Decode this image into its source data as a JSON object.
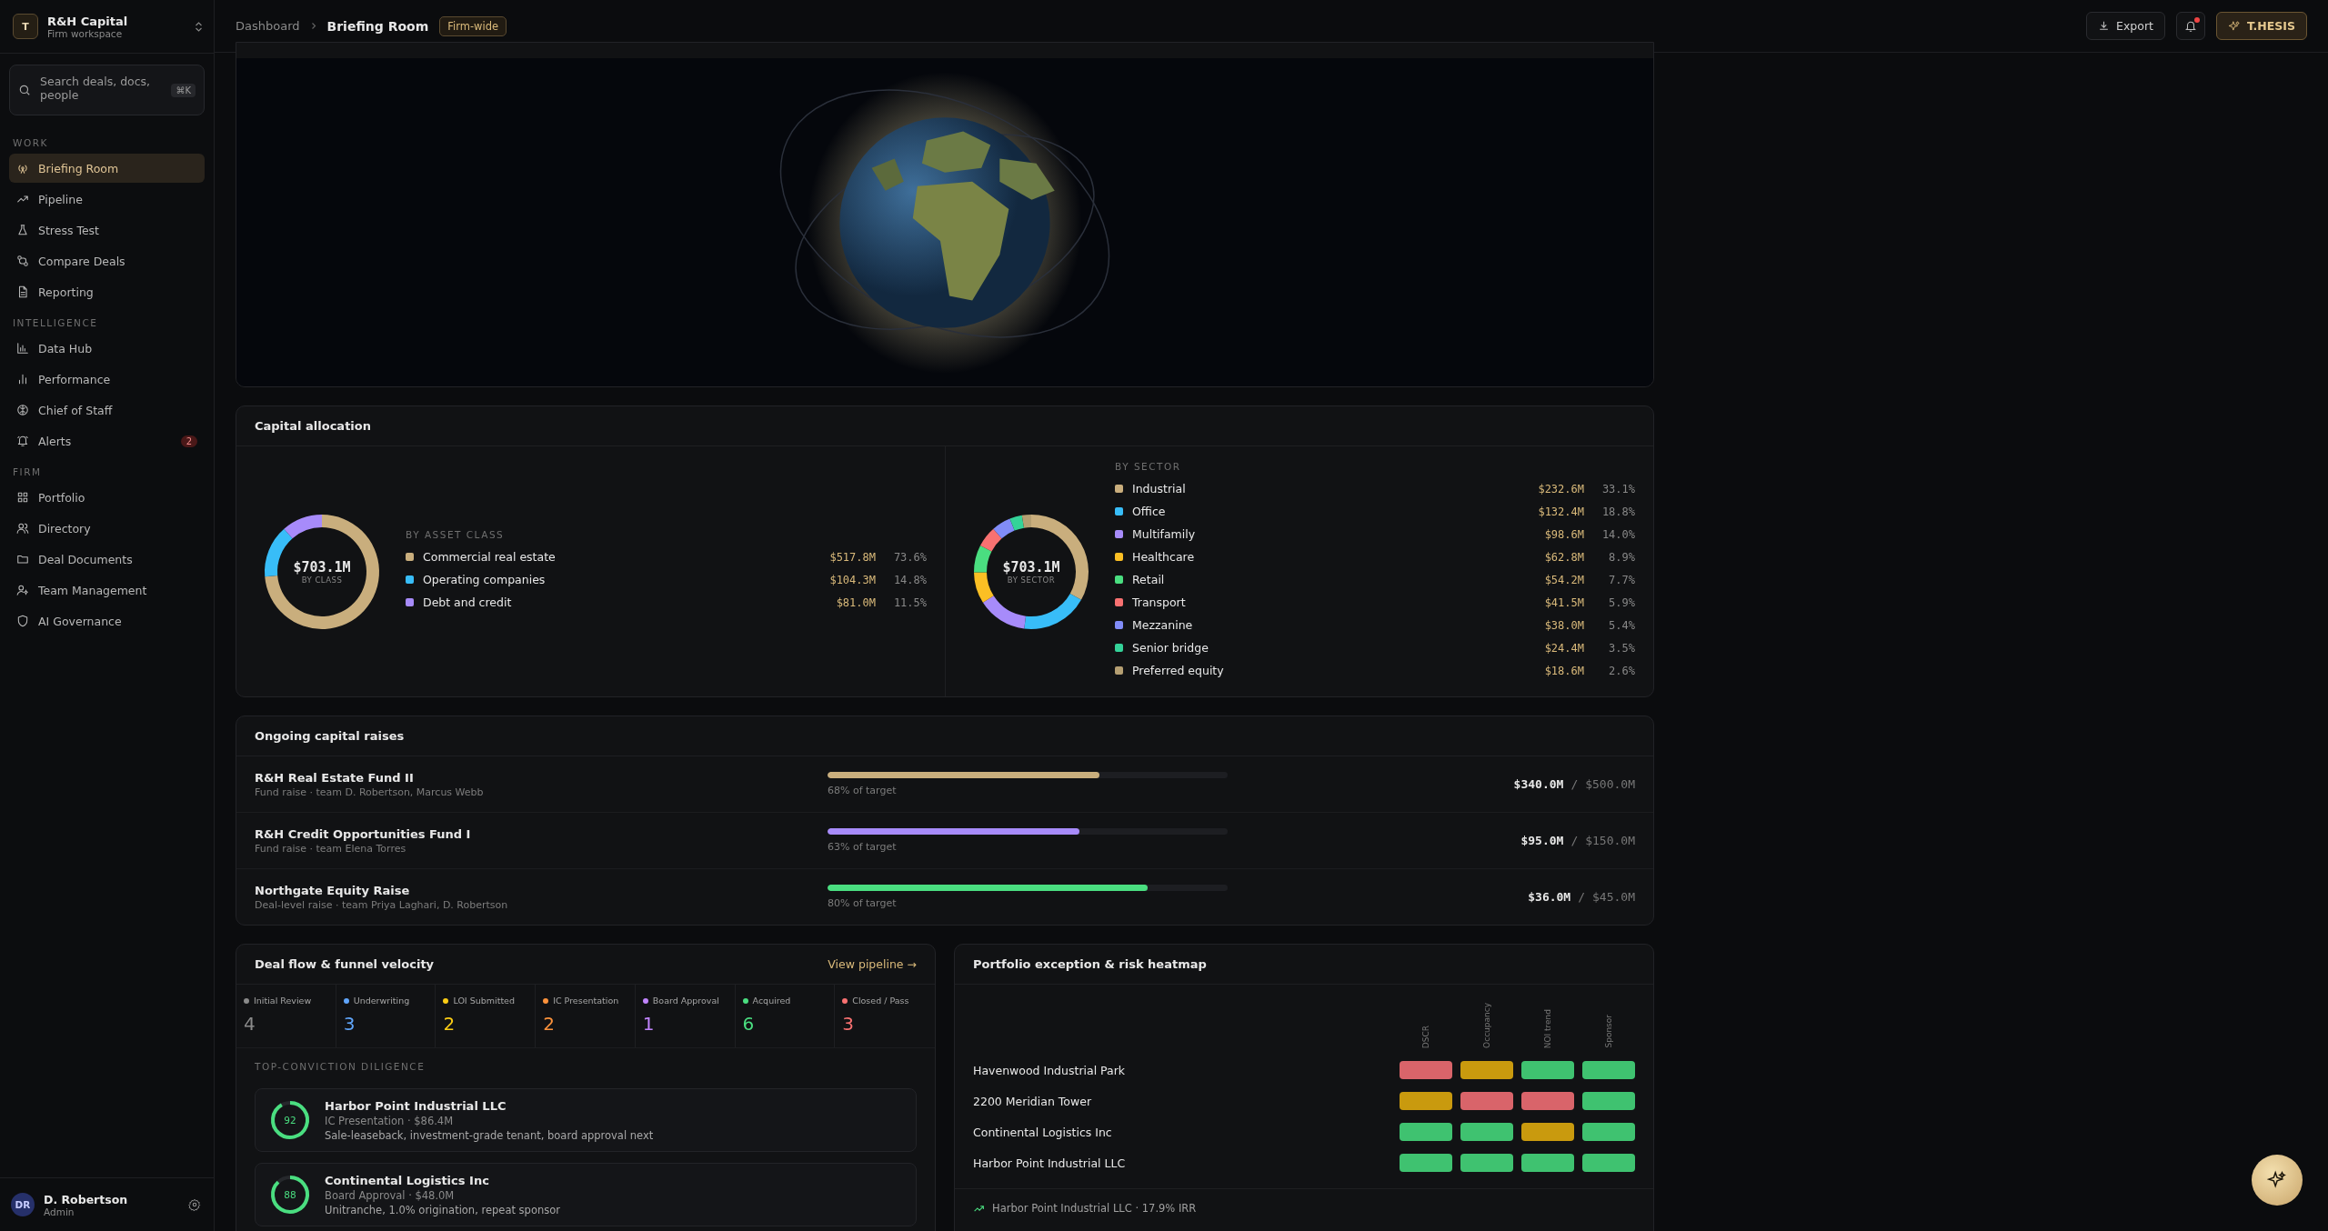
{
  "sidebar": {
    "logo": "T",
    "org": "R&H Capital",
    "workspace": "Firm workspace",
    "search": {
      "placeholder": "Search deals, docs, people",
      "shortcut": "⌘K"
    },
    "sections": [
      {
        "title": "WORK",
        "items": [
          {
            "label": "Briefing Room",
            "selected": true
          },
          {
            "label": "Pipeline",
            "selected": false
          },
          {
            "label": "Stress Test",
            "selected": false
          },
          {
            "label": "Compare Deals",
            "selected": false
          },
          {
            "label": "Reporting",
            "selected": false
          }
        ]
      },
      {
        "title": "INTELLIGENCE",
        "items": [
          {
            "label": "Data Hub",
            "selected": false
          },
          {
            "label": "Performance",
            "selected": false
          },
          {
            "label": "Chief of Staff",
            "selected": false
          },
          {
            "label": "Alerts",
            "selected": false,
            "badge": "2"
          }
        ]
      },
      {
        "title": "FIRM",
        "items": [
          {
            "label": "Portfolio",
            "selected": false
          },
          {
            "label": "Directory",
            "selected": false
          },
          {
            "label": "Deal Documents",
            "selected": false
          },
          {
            "label": "Team Management",
            "selected": false
          },
          {
            "label": "AI Governance",
            "selected": false
          }
        ]
      }
    ],
    "user": {
      "initials": "DR",
      "name": "D. Robertson",
      "role": "Admin"
    }
  },
  "topbar": {
    "breadcrumb": [
      "Dashboard",
      "Briefing Room"
    ],
    "scope": "Firm-wide",
    "export": "Export",
    "notifications_unread": true,
    "assistant": "T.HESIS"
  },
  "capital_allocation": {
    "title": "Capital allocation",
    "panels": [
      {
        "total": "$703.1M",
        "center_label": "BY CLASS",
        "heading": "BY ASSET CLASS",
        "chart_data": {
          "type": "donut",
          "categories": [
            "Commercial real estate",
            "Operating companies",
            "Debt and credit"
          ],
          "values": [
            73.6,
            14.8,
            11.5
          ]
        },
        "legend": [
          {
            "amount": "$517.8M",
            "share": "73.6%",
            "color": "#c9ae7d"
          },
          {
            "amount": "$104.3M",
            "share": "14.8%",
            "color": "#38bdf8"
          },
          {
            "amount": "$81.0M",
            "share": "11.5%",
            "color": "#a78bfa"
          }
        ]
      },
      {
        "total": "$703.1M",
        "center_label": "BY SECTOR",
        "heading": "BY SECTOR",
        "chart_data": {
          "type": "donut",
          "categories": [
            "Industrial",
            "Office",
            "Multifamily",
            "Healthcare",
            "Retail",
            "Transport",
            "Mezzanine",
            "Senior bridge",
            "Preferred equity"
          ],
          "values": [
            33.1,
            18.8,
            14.0,
            8.9,
            7.7,
            5.9,
            5.4,
            3.5,
            2.6
          ]
        },
        "legend": [
          {
            "amount": "$232.6M",
            "share": "33.1%",
            "color": "#c9ae7d"
          },
          {
            "amount": "$132.4M",
            "share": "18.8%",
            "color": "#38bdf8"
          },
          {
            "amount": "$98.6M",
            "share": "14.0%",
            "color": "#a78bfa"
          },
          {
            "amount": "$62.8M",
            "share": "8.9%",
            "color": "#fbbf24"
          },
          {
            "amount": "$54.2M",
            "share": "7.7%",
            "color": "#4ade80"
          },
          {
            "amount": "$41.5M",
            "share": "5.9%",
            "color": "#f87171"
          },
          {
            "amount": "$38.0M",
            "share": "5.4%",
            "color": "#818cf8"
          },
          {
            "amount": "$24.4M",
            "share": "3.5%",
            "color": "#34d399"
          },
          {
            "amount": "$18.6M",
            "share": "2.6%",
            "color": "#b59f72"
          }
        ]
      }
    ]
  },
  "capital_raises": {
    "title": "Ongoing capital raises",
    "rows": [
      {
        "name": "R&H Real Estate Fund II",
        "detail": "Fund raise · team D. Robertson, Marcus Webb",
        "level": 0.68,
        "progress": "68% of target",
        "color": "#c9ae7d",
        "raised": "$340.0M",
        "separator": "/",
        "target": "$500.0M"
      },
      {
        "name": "R&H Credit Opportunities Fund I",
        "detail": "Fund raise · team Elena Torres",
        "level": 0.63,
        "progress": "63% of target",
        "color": "#a78bfa",
        "raised": "$95.0M",
        "separator": "/",
        "target": "$150.0M"
      },
      {
        "name": "Northgate Equity Raise",
        "detail": "Deal-level raise · team Priya Laghari, D. Robertson",
        "level": 0.8,
        "progress": "80% of target",
        "color": "#4ade80",
        "raised": "$36.0M",
        "separator": "/",
        "target": "$45.0M"
      }
    ]
  },
  "deal_flow": {
    "title": "Deal flow & funnel velocity",
    "link": "View pipeline →",
    "stages": [
      {
        "label": "Initial Review",
        "count": "4",
        "color": "#8a8a8a"
      },
      {
        "label": "Underwriting",
        "count": "3",
        "color": "#60a5fa"
      },
      {
        "label": "LOI Submitted",
        "count": "2",
        "color": "#facc15"
      },
      {
        "label": "IC Presentation",
        "count": "2",
        "color": "#fb923c"
      },
      {
        "label": "Board Approval",
        "count": "1",
        "color": "#c084fc"
      },
      {
        "label": "Acquired",
        "count": "6",
        "color": "#4ade80"
      },
      {
        "label": "Closed / Pass",
        "count": "3",
        "color": "#f87171"
      }
    ],
    "diligence_heading": "TOP-CONVICTION DILIGENCE",
    "diligence": [
      {
        "score": "92",
        "name": "Harbor Point Industrial LLC",
        "stage": "IC Presentation · $86.4M",
        "note": "Sale-leaseback, investment-grade tenant, board approval next"
      },
      {
        "score": "88",
        "name": "Continental Logistics Inc",
        "stage": "Board Approval · $48.0M",
        "note": "Unitranche, 1.0% origination, repeat sponsor"
      }
    ]
  },
  "heatmap": {
    "title": "Portfolio exception & risk heatmap",
    "columns": [
      "DSCR",
      "Occupancy",
      "NOI trend",
      "Sponsor"
    ],
    "rows": [
      {
        "name": "Havenwood Industrial Park",
        "cells": [
          {
            "color": "#d9646a"
          },
          {
            "color": "#c99a0e"
          },
          {
            "color": "#3fc270"
          },
          {
            "color": "#3fc270"
          }
        ]
      },
      {
        "name": "2200 Meridian Tower",
        "cells": [
          {
            "color": "#c99a0e"
          },
          {
            "color": "#d9646a"
          },
          {
            "color": "#d9646a"
          },
          {
            "color": "#3fc270"
          }
        ]
      },
      {
        "name": "Continental Logistics Inc",
        "cells": [
          {
            "color": "#3fc270"
          },
          {
            "color": "#3fc270"
          },
          {
            "color": "#c99a0e"
          },
          {
            "color": "#3fc270"
          }
        ]
      },
      {
        "name": "Harbor Point Industrial LLC",
        "cells": [
          {
            "color": "#3fc270"
          },
          {
            "color": "#3fc270"
          },
          {
            "color": "#3fc270"
          },
          {
            "color": "#3fc270"
          }
        ]
      }
    ],
    "footer": "Harbor Point Industrial LLC · 17.9% IRR"
  }
}
